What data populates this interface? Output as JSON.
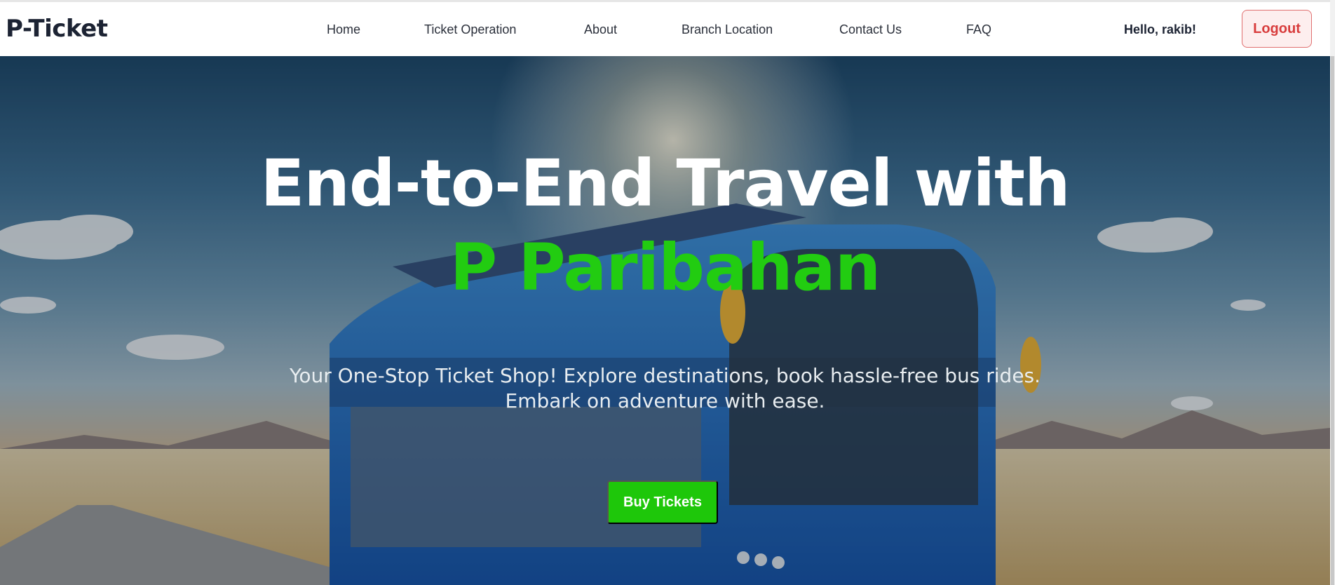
{
  "brand": "P-Ticket",
  "nav": {
    "items": [
      {
        "label": "Home"
      },
      {
        "label": "Ticket Operation"
      },
      {
        "label": "About"
      },
      {
        "label": "Branch Location"
      },
      {
        "label": "Contact Us"
      },
      {
        "label": "FAQ"
      }
    ],
    "greeting": "Hello, rakib!",
    "logout_label": "Logout"
  },
  "hero": {
    "title": "End-to-End Travel with",
    "accent": "P Paribahan",
    "subtitle_line1": "Your One-Stop Ticket Shop! Explore destinations, book hassle-free bus rides.",
    "subtitle_line2": "Embark on adventure with ease.",
    "cta_label": "Buy Tickets",
    "background": "bus-on-desert-road-image"
  },
  "colors": {
    "accent_green": "#22cc11",
    "button_green": "#1ec70a",
    "logout_red": "#d83c3c",
    "brand_dark": "#1c2333"
  }
}
